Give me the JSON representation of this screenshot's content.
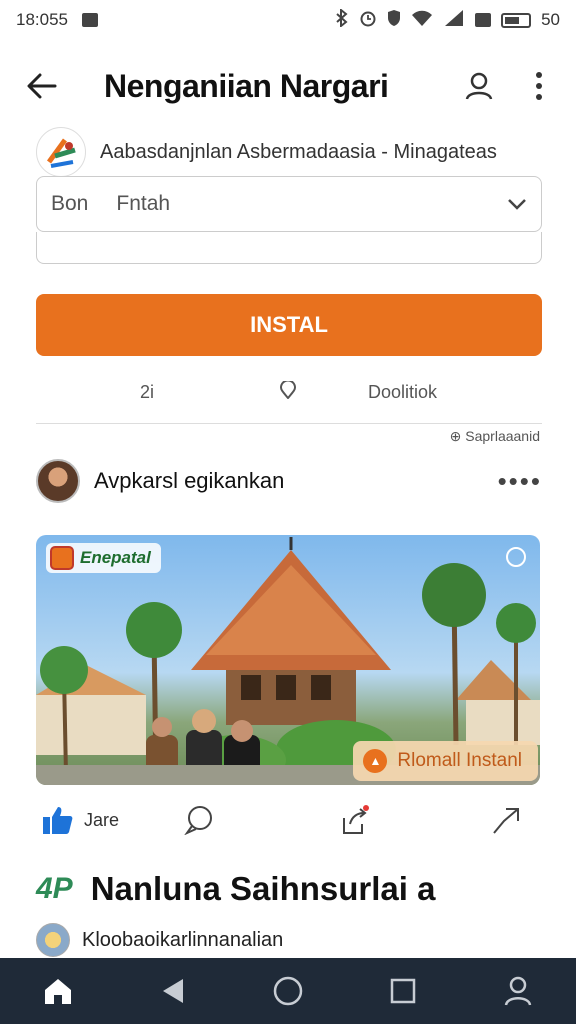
{
  "status_bar": {
    "time": "18:055",
    "battery": "50"
  },
  "app_bar": {
    "title": "Nenganiian Nargari"
  },
  "app_info": {
    "description": "Aabasdanjnlan Asbermadaasia - Minagateas"
  },
  "select_field": {
    "value_left": "Bon",
    "value_right": "Fntah"
  },
  "install_button": {
    "label": "INSTAL"
  },
  "stats": {
    "a": "2i",
    "c": "Doolitiok"
  },
  "sponsored_label": "Saprlaaanid",
  "post": {
    "author": "Avpkarsl egikankan",
    "more": "••••",
    "image_badge": "Enepatal",
    "overlay_label": "Rlomall Instanl"
  },
  "actions": {
    "like_label": "Jare"
  },
  "section": {
    "icon_text": "4P",
    "title": "Nanluna Saihnsurlai a"
  },
  "sub": {
    "label": "Kloobaoikarlinnanalian"
  },
  "colors": {
    "accent": "#e8711e",
    "nav_bg": "#1f2a38",
    "like_blue": "#1e73d8"
  },
  "icons": [
    "back-arrow-icon",
    "profile-icon",
    "more-vert-icon",
    "chevron-down-icon",
    "comment-icon",
    "share-icon",
    "send-icon",
    "home-icon",
    "nav-back-icon",
    "nav-home-circle-icon",
    "nav-recents-icon",
    "nav-profile-icon"
  ]
}
